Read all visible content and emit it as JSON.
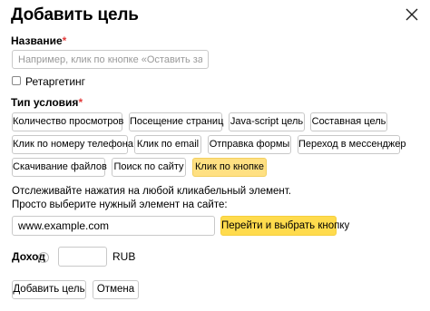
{
  "dialog": {
    "title": "Добавить цель"
  },
  "name_field": {
    "label": "Название",
    "required_mark": "*",
    "placeholder": "Например, клик по кнопке «Оставить заявку»",
    "value": ""
  },
  "retargeting": {
    "label": "Ретаргетинг",
    "checked": false
  },
  "condition": {
    "label": "Тип условия",
    "required_mark": "*",
    "types": [
      {
        "label": "Количество просмотров",
        "selected": false
      },
      {
        "label": "Посещение страниц",
        "selected": false
      },
      {
        "label": "Java-script цель",
        "selected": false
      },
      {
        "label": "Составная цель",
        "selected": false
      },
      {
        "label": "Клик по номеру телефона",
        "selected": false
      },
      {
        "label": "Клик по email",
        "selected": false
      },
      {
        "label": "Отправка формы",
        "selected": false
      },
      {
        "label": "Переход в мессенджер",
        "selected": false
      },
      {
        "label": "Скачивание файлов",
        "selected": false
      },
      {
        "label": "Поиск по сайту",
        "selected": false
      },
      {
        "label": "Клик по кнопке",
        "selected": true
      }
    ]
  },
  "instructions": {
    "line1": "Отслеживайте нажатия на любой кликабельный элемент.",
    "line2": "Просто выберите нужный элемент на сайте:"
  },
  "url_field": {
    "value": "www.example.com"
  },
  "pick_button": {
    "label": "Перейти и выбрать кнопку"
  },
  "income": {
    "label": "Доход",
    "help_icon_glyph": "?",
    "value": "",
    "currency": "RUB"
  },
  "footer": {
    "add_label": "Добавить цель",
    "cancel_label": "Отмена"
  },
  "colors": {
    "accent_yellow": "#ffdb4d",
    "selected_chip": "#ffe082",
    "required": "#e23b3b"
  }
}
